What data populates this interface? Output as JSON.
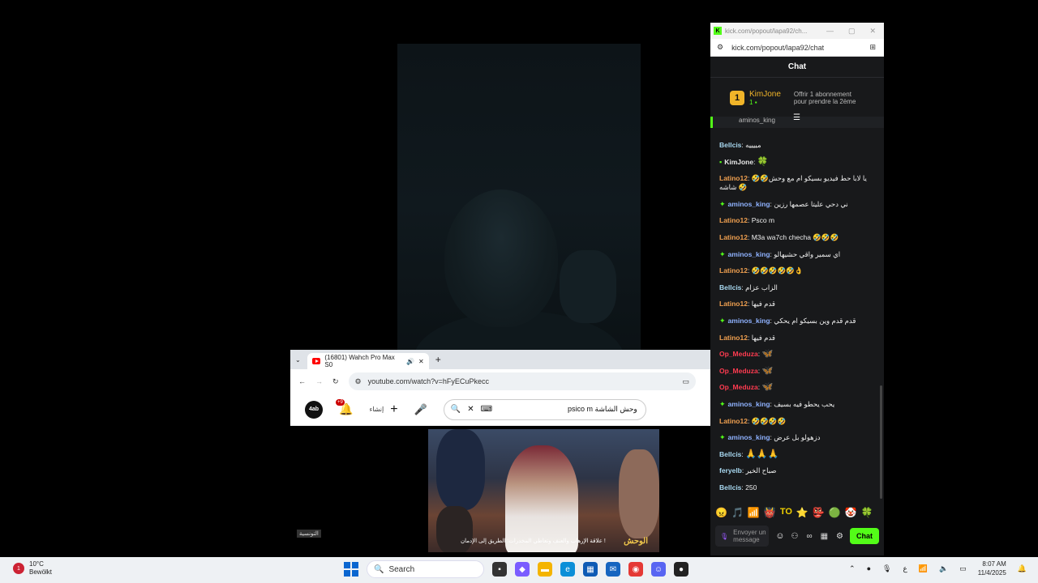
{
  "youtube_window": {
    "tab_title": "(16801) Wahch Pro Max S0",
    "new_tab": "+",
    "url": "youtube.com/watch?v=hFyECuPkecc",
    "bell_badge": "+9",
    "create_label": "إنشاء",
    "search_query": "psico m وحش الشاشة",
    "channel_tag": "التونسية",
    "video_caption": "علاقة الإرهاب والعنف وتعاطي المخدرات: الطريق إلى الإدمان !",
    "video_brand": "الوحش"
  },
  "kick_window": {
    "window_title": "kick.com/popout/lapa92/ch...",
    "url": "kick.com/popout/lapa92/chat",
    "chat_header": "Chat",
    "pinned": {
      "rank": "1",
      "name": "KimJone",
      "sub_count": "1",
      "offer_line1": "Offrir 1 abonnement",
      "offer_line2": "pour prendre la 2ème"
    },
    "partial_user": "aminos_king",
    "messages": [
      {
        "user": "Bellcis",
        "color": "#a8d8f0",
        "badge": "",
        "text": "مييييه"
      },
      {
        "user": "KimJone",
        "color": "#e8e8e8",
        "badge": "gift",
        "text": "",
        "emote": "🍀"
      },
      {
        "user": "Latino12",
        "color": "#f0a050",
        "badge": "",
        "text": "🤣🤣يا لابا حط فيديو بسيكو ام مع وحش شاشه 🤣"
      },
      {
        "user": "aminos_king",
        "color": "#8fb2ff",
        "badge": "sparkle",
        "text": "ني دحي عليتا عصمها رزين"
      },
      {
        "user": "Latino12",
        "color": "#f0a050",
        "badge": "",
        "text": "Psco m"
      },
      {
        "user": "Latino12",
        "color": "#f0a050",
        "badge": "",
        "text": "M3a wa7ch checha 🤣🤣🤣"
      },
      {
        "user": "aminos_king",
        "color": "#8fb2ff",
        "badge": "sparkle",
        "text": "اي سمير واقي حشيهالو"
      },
      {
        "user": "Latino12",
        "color": "#f0a050",
        "badge": "",
        "text": "🤣🤣🤣🤣🤣👌"
      },
      {
        "user": "Bellcis",
        "color": "#a8d8f0",
        "badge": "",
        "text": "الزاب عزام"
      },
      {
        "user": "Latino12",
        "color": "#f0a050",
        "badge": "",
        "text": "قدم فيها"
      },
      {
        "user": "aminos_king",
        "color": "#8fb2ff",
        "badge": "sparkle",
        "text": "قدم قدم وين بسيكو ام يحكي"
      },
      {
        "user": "Latino12",
        "color": "#f0a050",
        "badge": "",
        "text": "قدم فيها"
      },
      {
        "user": "Op_Meduza",
        "color": "#ff3b50",
        "badge": "",
        "text": "",
        "emote": "🦋"
      },
      {
        "user": "Op_Meduza",
        "color": "#ff3b50",
        "badge": "",
        "text": "",
        "emote": "🦋"
      },
      {
        "user": "Op_Meduza",
        "color": "#ff3b50",
        "badge": "",
        "text": "",
        "emote": "🦋"
      },
      {
        "user": "aminos_king",
        "color": "#8fb2ff",
        "badge": "sparkle",
        "text": "يحب يحطو فيه بسيف"
      },
      {
        "user": "Latino12",
        "color": "#f0a050",
        "badge": "",
        "text": "🤣🤣🤣🤣"
      },
      {
        "user": "aminos_king",
        "color": "#8fb2ff",
        "badge": "sparkle",
        "text": "دزهولو بل عرض"
      },
      {
        "user": "Bellcis",
        "color": "#a8d8f0",
        "badge": "",
        "text": "",
        "emote": "🙏🙏🙏"
      },
      {
        "user": "feryelb",
        "color": "#a8d8f0",
        "badge": "",
        "text": "صباح الخير"
      },
      {
        "user": "Bellcis",
        "color": "#a8d8f0",
        "badge": "",
        "text": "250"
      }
    ],
    "emote_bar": [
      "😠",
      "🎵",
      "📶",
      "👹",
      "TO",
      "⭐",
      "👺",
      "🟢",
      "🤡",
      "🍀"
    ],
    "input_placeholder": "Envoyer un message",
    "send_label": "Chat"
  },
  "taskbar": {
    "weather_temp": "10°C",
    "weather_desc": "Bewölkt",
    "weather_badge": "1",
    "search_label": "Search",
    "time": "8:07 AM",
    "date": "11/4/2025",
    "lang": "ع"
  },
  "colors": {
    "kick_green": "#53fc18",
    "chat_bg": "#18191b",
    "taskbar_bg": "#eef1f4"
  }
}
